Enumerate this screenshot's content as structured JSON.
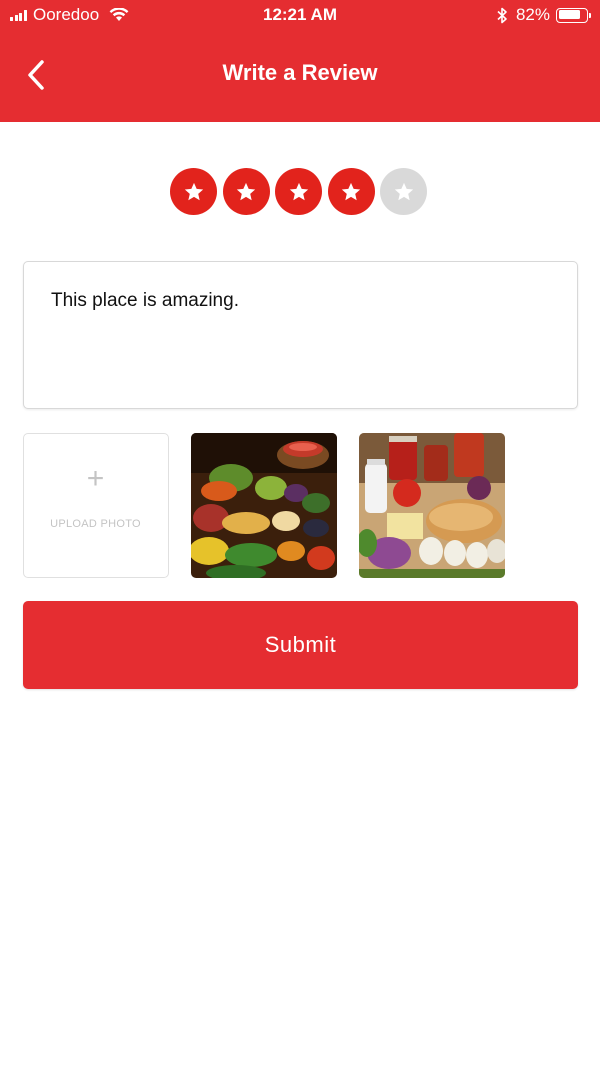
{
  "status_bar": {
    "carrier": "Ooredoo",
    "time": "12:21 AM",
    "battery_percent_label": "82%",
    "battery_level": 0.82
  },
  "header": {
    "title": "Write a Review",
    "back_icon": "chevron-left-icon"
  },
  "rating": {
    "value": 4,
    "max": 5
  },
  "review": {
    "text": "This place is amazing."
  },
  "photos": {
    "upload_icon": "plus-icon",
    "upload_label": "UPLOAD PHOTO",
    "items": [
      {
        "subject": "fresh vegetables and fruits"
      },
      {
        "subject": "groceries with bread, eggs and cheese"
      }
    ]
  },
  "submit": {
    "label": "Submit"
  },
  "colors": {
    "accent": "#e52d31",
    "star_active": "#e2231c",
    "star_inactive": "#d9d9d9"
  }
}
